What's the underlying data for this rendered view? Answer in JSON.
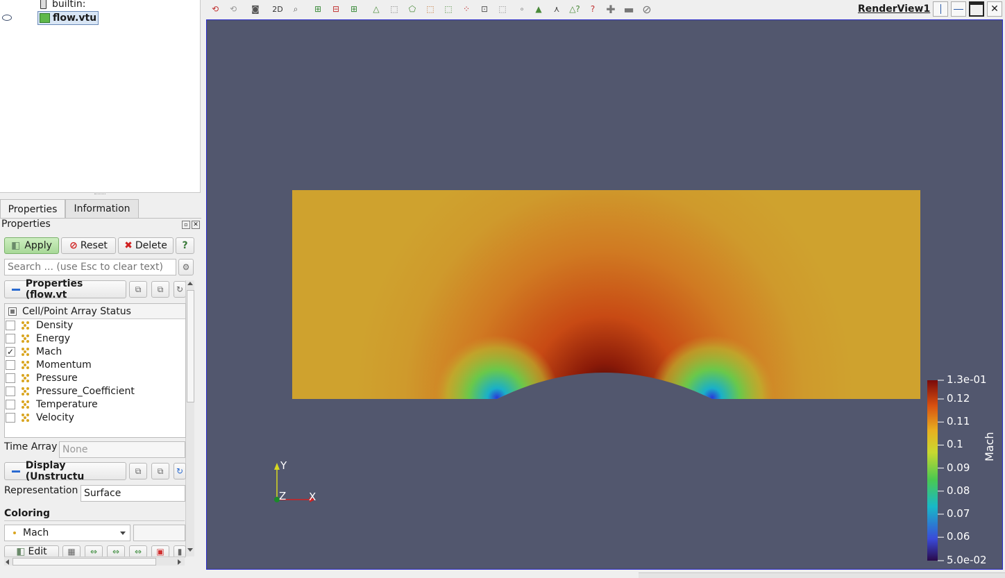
{
  "pipeline": {
    "items": [
      {
        "label": "builtin:"
      },
      {
        "label": "flow.vtu"
      }
    ]
  },
  "tabs": [
    {
      "label": "Properties"
    },
    {
      "label": "Information"
    }
  ],
  "properties_panel": {
    "title": "Properties",
    "apply_label": "Apply",
    "reset_label": "Reset",
    "delete_label": "Delete",
    "help_label": "?",
    "search_placeholder": "Search ... (use Esc to clear text)",
    "section_properties": "Properties (flow.vt",
    "array_status_header": "Cell/Point Array Status",
    "arrays": [
      {
        "name": "Density",
        "checked": ""
      },
      {
        "name": "Energy",
        "checked": ""
      },
      {
        "name": "Mach",
        "checked": "✓"
      },
      {
        "name": "Momentum",
        "checked": ""
      },
      {
        "name": "Pressure",
        "checked": ""
      },
      {
        "name": "Pressure_Coefficient",
        "checked": ""
      },
      {
        "name": "Temperature",
        "checked": ""
      },
      {
        "name": "Velocity",
        "checked": ""
      }
    ],
    "time_array_label": "Time Array",
    "time_array_value": "None",
    "section_display": "Display (Unstructu",
    "representation_label": "Representation",
    "representation_value": "Surface",
    "coloring_label": "Coloring",
    "coloring_value": "Mach",
    "edit_label": "Edit"
  },
  "toolbar": {
    "view_title": "RenderView1",
    "mode_2d": "2D"
  },
  "colorbar": {
    "title": "Mach",
    "labels": [
      "1.3e-01",
      "0.12",
      "0.11",
      "0.1",
      "0.09",
      "0.08",
      "0.07",
      "0.06",
      "5.0e-02"
    ]
  },
  "axes": {
    "x": "X",
    "y": "Y",
    "z": "Z"
  },
  "colors": {
    "background": "#52576e",
    "accent": "#2a2ac8",
    "apply_green": "#b8e3a8"
  }
}
